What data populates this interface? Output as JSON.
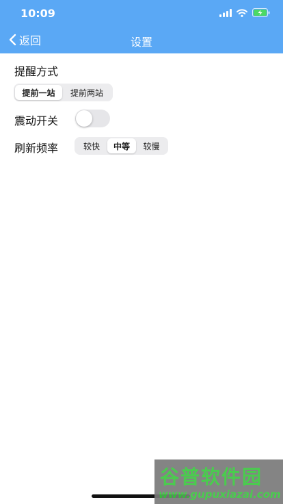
{
  "status_bar": {
    "time": "10:09",
    "icons": [
      "signal-icon",
      "wifi-icon",
      "battery-charging-icon"
    ]
  },
  "nav": {
    "back_label": "返回",
    "title": "设置"
  },
  "settings": {
    "reminder": {
      "label": "提醒方式",
      "options": [
        "提前一站",
        "提前两站"
      ],
      "selected": "提前一站"
    },
    "vibration": {
      "label": "震动开关",
      "enabled": false
    },
    "refresh": {
      "label": "刷新频率",
      "options": [
        "较快",
        "中等",
        "较慢"
      ],
      "selected": "中等"
    }
  },
  "watermark": {
    "title": "谷普软件园",
    "url": "www.gupuxiazai.com"
  },
  "colors": {
    "header_bg": "#5aa8f5",
    "watermark_text": "#3bc840"
  }
}
